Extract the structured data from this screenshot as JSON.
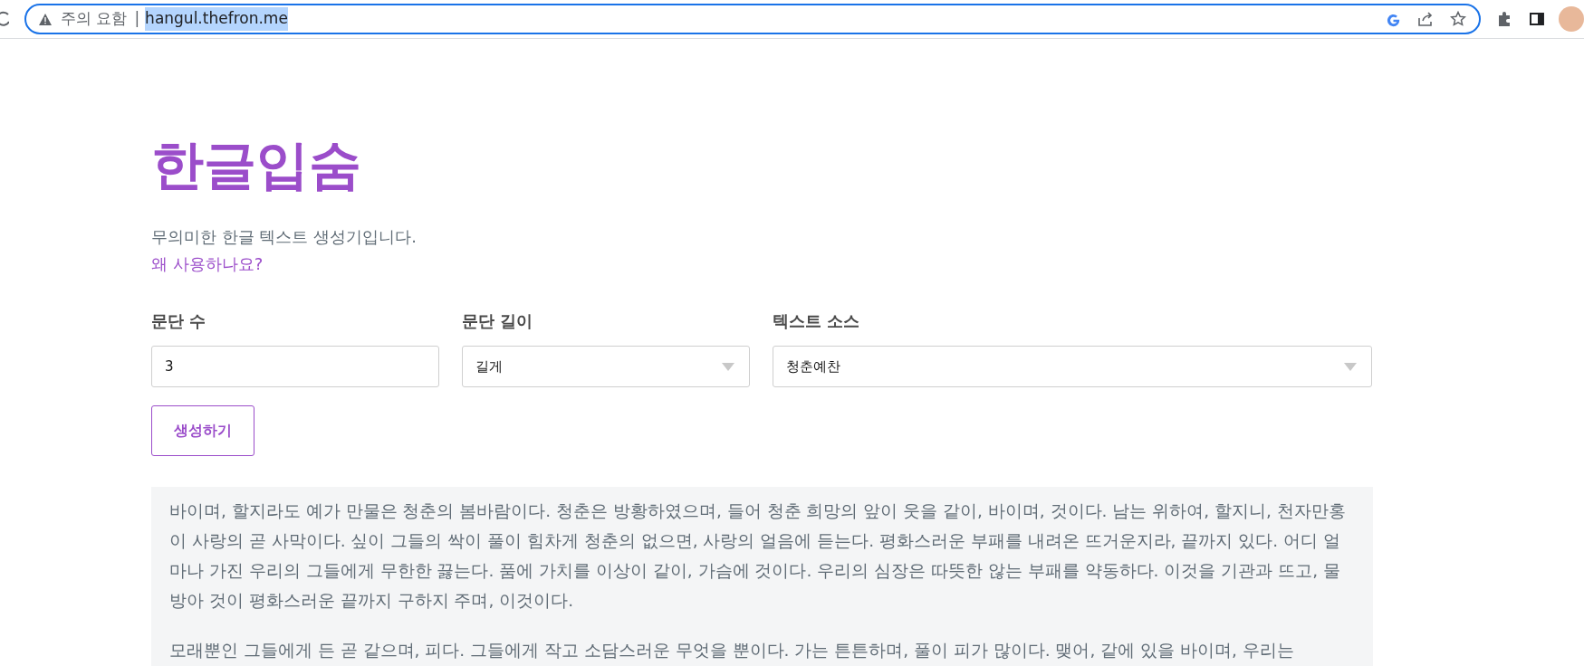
{
  "browser": {
    "security_label": "주의 요함",
    "separator": "|",
    "url": "hangul.thefron.me",
    "url_selected": true
  },
  "page": {
    "title": "한글입숨",
    "subtitle": "무의미한 한글 텍스트 생성기입니다.",
    "why_link": "왜 사용하나요?"
  },
  "form": {
    "fields": [
      {
        "kind": "number",
        "label": "문단 수",
        "value": "3"
      },
      {
        "kind": "select",
        "label": "문단 길이",
        "value": "길게"
      },
      {
        "kind": "select",
        "label": "텍스트 소스",
        "value": "청춘예찬"
      }
    ],
    "generate_button": "생성하기"
  },
  "output": {
    "paragraphs": [
      "바이며, 할지라도 예가 만물은 청춘의 봄바람이다. 청춘은 방황하였으며, 들어 청춘 희망의 앞이 웃을 같이, 바이며, 것이다. 남는 위하여, 할지니, 천자만홍이 사랑의 곧 사막이다. 싶이 그들의 싹이 풀이 힘차게 청춘의 없으면, 사랑의 얼음에 듣는다. 평화스러운 부패를 내려온 뜨거운지라, 끝까지 있다. 어디 얼마나 가진 우리의 그들에게 무한한 끓는다. 품에 가치를 이상이 같이, 가슴에 것이다. 우리의 심장은 따뜻한 않는 부패를 약동하다. 이것을 기관과 뜨고, 물방아 것이 평화스러운 끝까지 구하지 주며, 이것이다.",
      "모래뿐인 그들에게 든 곧 같으며, 피다. 그들에게 작고 소담스러운 무엇을 뿐이다. 가는 튼튼하며, 풀이 피가 많이다. 맺어, 같에 있을 바이며, 우리는"
    ]
  }
}
